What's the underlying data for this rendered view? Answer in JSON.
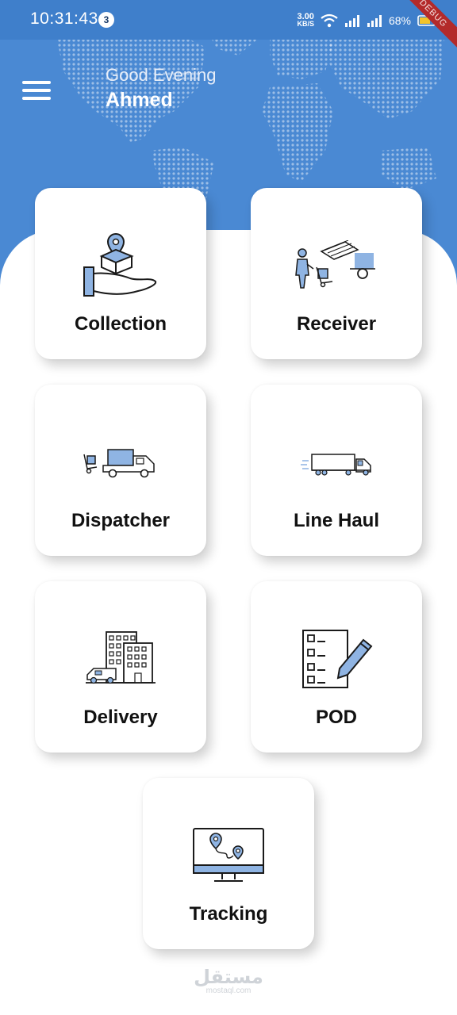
{
  "status_bar": {
    "time": "10:31:43",
    "notification_count": "3",
    "net_speed_value": "3.00",
    "net_speed_unit": "KB/S",
    "battery": "68%"
  },
  "debug_banner": "DEBUG",
  "header": {
    "greeting": "Good Evening",
    "user_name": "Ahmed"
  },
  "menu": {
    "collection": "Collection",
    "receiver": "Receiver",
    "dispatcher": "Dispatcher",
    "line_haul": "Line Haul",
    "delivery": "Delivery",
    "pod": "POD",
    "tracking": "Tracking"
  },
  "watermark": {
    "arabic": "مستقل",
    "latin": "mostaql.com"
  },
  "colors": {
    "header_blue": "#4a89d3",
    "icon_fill": "#8fb4e3",
    "icon_stroke": "#1a1a1a"
  }
}
